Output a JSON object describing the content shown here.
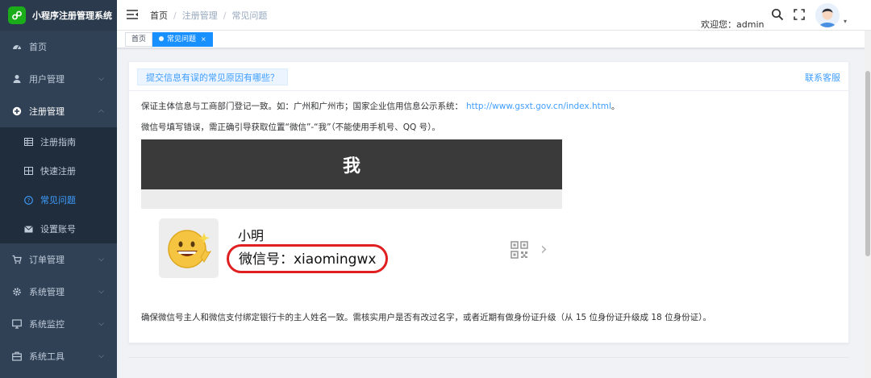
{
  "app": {
    "title": "小程序注册管理系统",
    "brand_color": "#1aad19"
  },
  "sidebar": {
    "items": [
      {
        "label": "首页",
        "icon": "dashboard-icon"
      },
      {
        "label": "用户管理",
        "icon": "user-icon",
        "has_children": true
      },
      {
        "label": "注册管理",
        "icon": "plus-circle-icon",
        "has_children": true,
        "expanded": true
      },
      {
        "label": "订单管理",
        "icon": "cart-icon",
        "has_children": true
      },
      {
        "label": "系统管理",
        "icon": "gear-icon",
        "has_children": true
      },
      {
        "label": "系统监控",
        "icon": "monitor-icon",
        "has_children": true
      },
      {
        "label": "系统工具",
        "icon": "toolbox-icon",
        "has_children": true
      }
    ],
    "sub_items": [
      {
        "label": "注册指南",
        "icon": "table-icon"
      },
      {
        "label": "快速注册",
        "icon": "grid-icon"
      },
      {
        "label": "常见问题",
        "icon": "question-icon",
        "active": true
      },
      {
        "label": "设置账号",
        "icon": "mail-icon"
      }
    ]
  },
  "header": {
    "breadcrumb": [
      "首页",
      "注册管理",
      "常见问题"
    ],
    "welcome": "欢迎您：admin"
  },
  "tags": [
    {
      "label": "首页"
    },
    {
      "label": "常见问题",
      "active": true,
      "close": "×"
    }
  ],
  "content": {
    "question": "提交信息有误的常见原因有哪些？",
    "contact": "联系客服",
    "p1": "保证主体信息与工商部门登记一致。如：广州和广州市；国家企业信用信息公示系统：",
    "p1_link": "http://www.gsxt.gov.cn/index.html",
    "p1_end": "。",
    "p2": "微信号填写错误，需正确引导获取位置“微信”-“我”（不能使用手机号、QQ 号）。",
    "illustration": {
      "top_title": "我",
      "name": "小明",
      "wechat_id": "微信号：xiaomingwx"
    },
    "p3": "确保微信号主人和微信支付绑定银行卡的主人姓名一致。需核实用户是否有改过名字，或者近期有做身份证升级（从 15 位身份证升级成 18 位身份证）。"
  }
}
